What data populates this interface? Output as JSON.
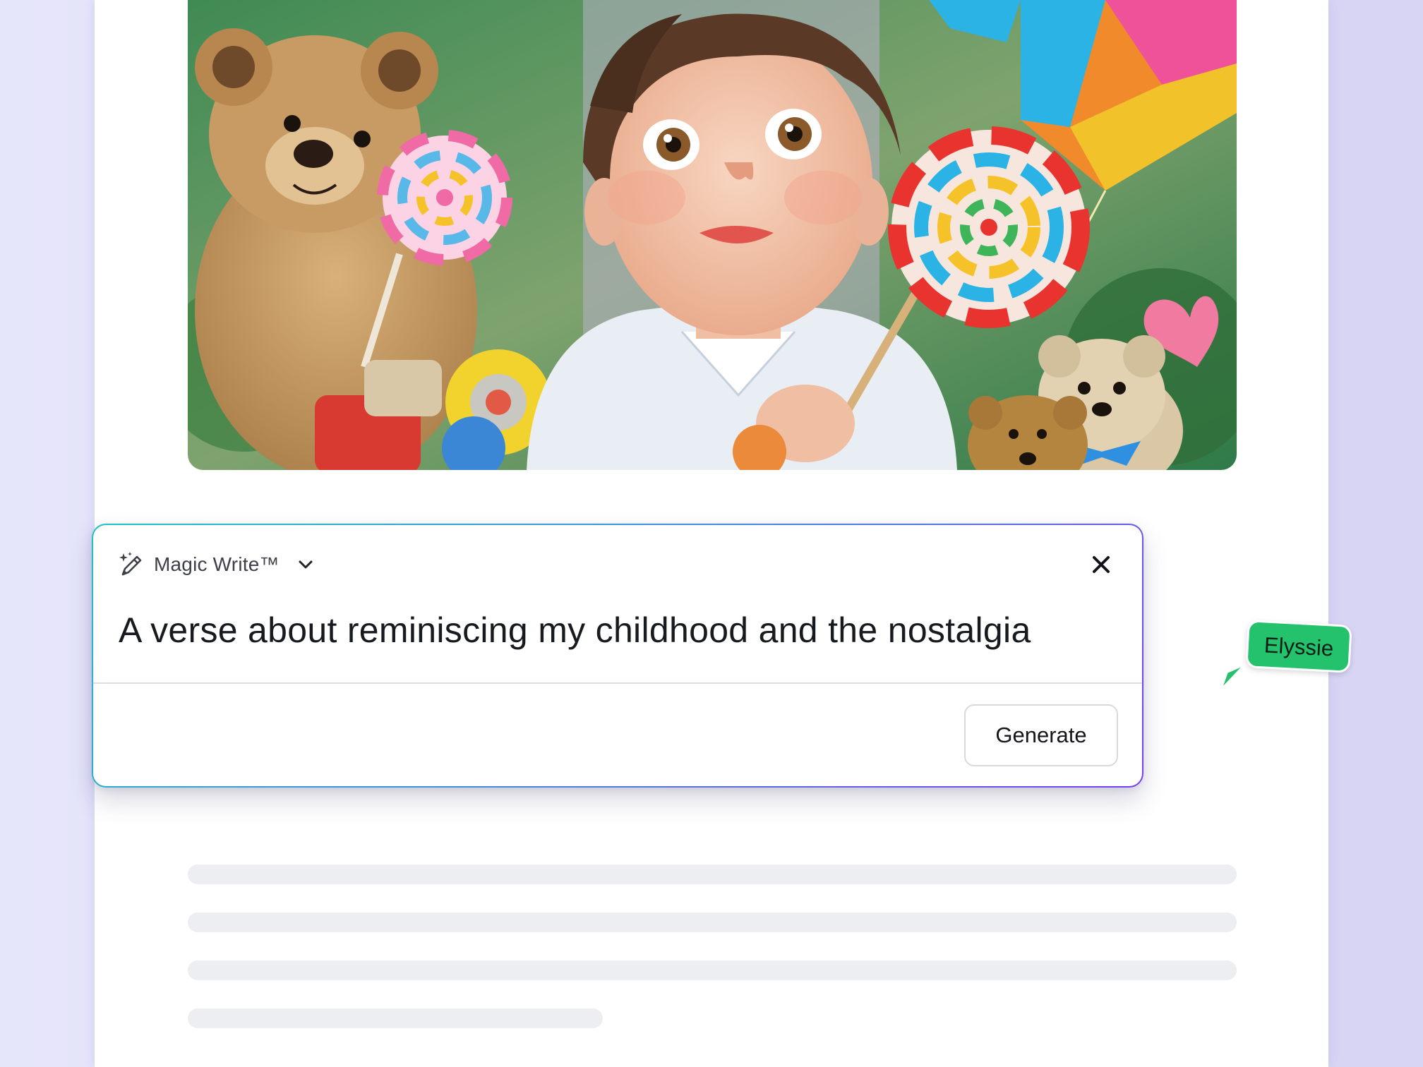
{
  "magic_write": {
    "title": "Magic Write™",
    "prompt_text": "A verse about reminiscing my childhood and the nostalgia",
    "generate_label": "Generate",
    "icons": {
      "brand": "magic-pencil-sparkle-icon",
      "dropdown": "chevron-down-icon",
      "close": "close-icon"
    }
  },
  "collaborator": {
    "name": "Elyssie",
    "color": "#25c26e"
  },
  "colors": {
    "gradient_start": "#1fc2c2",
    "gradient_end": "#7a3cf0",
    "page_background": "#e6e6fb"
  }
}
